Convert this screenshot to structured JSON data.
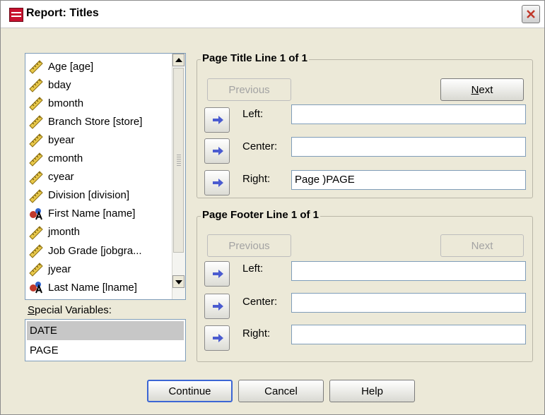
{
  "window": {
    "title": "Report: Titles"
  },
  "variables": [
    {
      "label": "Age [age]",
      "icon": "ruler-icon"
    },
    {
      "label": "bday",
      "icon": "ruler-icon"
    },
    {
      "label": "bmonth",
      "icon": "ruler-icon"
    },
    {
      "label": "Branch Store [store]",
      "icon": "ruler-icon"
    },
    {
      "label": "byear",
      "icon": "ruler-icon"
    },
    {
      "label": "cmonth",
      "icon": "ruler-icon"
    },
    {
      "label": "cyear",
      "icon": "ruler-icon"
    },
    {
      "label": "Division [division]",
      "icon": "ruler-icon"
    },
    {
      "label": "First Name [name]",
      "icon": "string-variable-icon"
    },
    {
      "label": "jmonth",
      "icon": "ruler-icon"
    },
    {
      "label": "Job Grade [jobgra...",
      "icon": "ruler-icon"
    },
    {
      "label": "jyear",
      "icon": "ruler-icon"
    },
    {
      "label": "Last Name [lname]",
      "icon": "string-variable-icon"
    }
  ],
  "special": {
    "label": "Special Variables:",
    "items": [
      "DATE",
      "PAGE"
    ]
  },
  "title_group": {
    "label": "Page Title Line 1 of 1",
    "previous": "Previous",
    "next": "Next",
    "left_label": "Left:",
    "center_label": "Center:",
    "right_label": "Right:",
    "left_value": "",
    "center_value": "",
    "right_value": "Page )PAGE"
  },
  "footer_group": {
    "label": "Page Footer Line 1 of 1",
    "previous": "Previous",
    "next": "Next",
    "left_label": "Left:",
    "center_label": "Center:",
    "right_label": "Right:",
    "left_value": "",
    "center_value": "",
    "right_value": ""
  },
  "buttons": {
    "continue": "Continue",
    "cancel": "Cancel",
    "help": "Help"
  },
  "colors": {
    "accent": "#3c66d4",
    "arrow": "#4a5bd0",
    "selection": "#c7c7c7"
  }
}
